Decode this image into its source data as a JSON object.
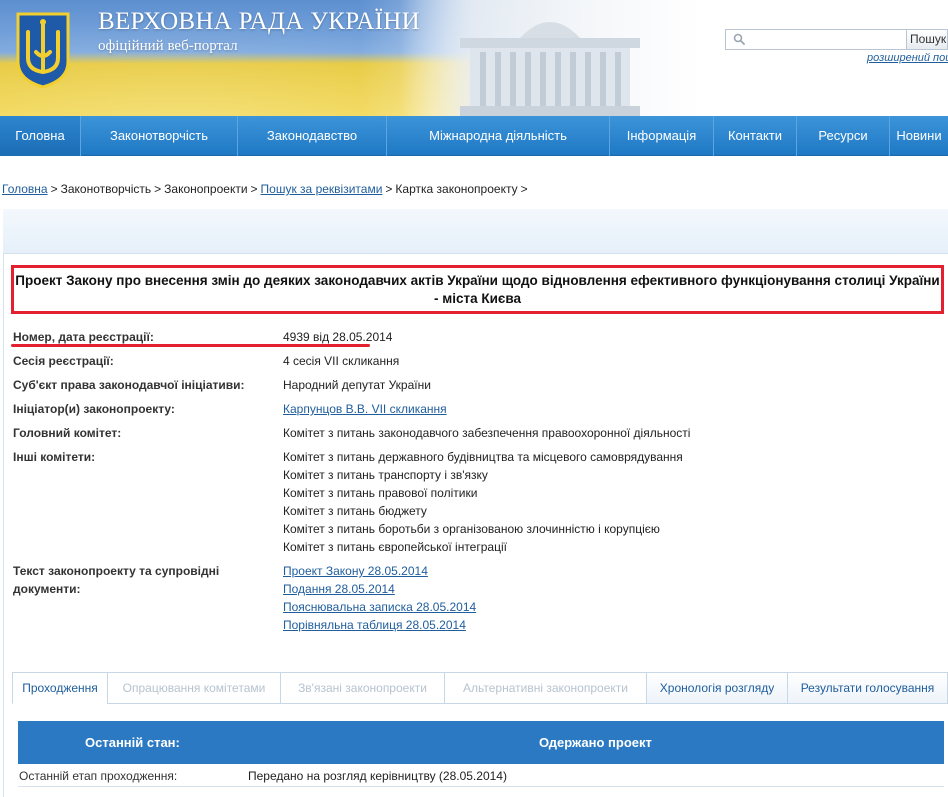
{
  "header": {
    "title": "ВЕРХОВНА РАДА УКРАЇНИ",
    "subtitle": "офіційний веб-портал",
    "search_placeholder": "",
    "search_button": "Пошук",
    "advanced_search": "розширений пошук",
    "coat_of_arms_icon": "trident-icon",
    "colors": {
      "flag_blue": "#5d8fd0",
      "flag_yellow": "#f1d64f"
    }
  },
  "nav": {
    "items": [
      {
        "label": "Головна"
      },
      {
        "label": "Законотворчість"
      },
      {
        "label": "Законодавство"
      },
      {
        "label": "Міжнародна діяльність"
      },
      {
        "label": "Інформація"
      },
      {
        "label": "Контакти"
      },
      {
        "label": "Ресурси"
      },
      {
        "label": "Новини"
      }
    ],
    "color": "#2a83cc"
  },
  "breadcrumb": {
    "items": [
      {
        "label": "Головна",
        "link": true
      },
      {
        "label": "Законотворчість",
        "link": false
      },
      {
        "label": "Законопроекти",
        "link": false
      },
      {
        "label": "Пошук за реквізитами",
        "link": true
      },
      {
        "label": "Картка законопроекту",
        "link": false
      }
    ],
    "separator": ">"
  },
  "bill": {
    "title": "Проект Закону про внесення змін до деяких законодавчих актів України щодо відновлення ефективного функціонування столиці України - міста Києва",
    "rows": {
      "number_label": "Номер, дата реєстрації:",
      "number_value": "4939 від 28.05.2014",
      "session_label": "Сесія реєстрації:",
      "session_value": "4 сесія VII скликання",
      "subject_label": "Суб'єкт права законодавчої ініціативи:",
      "subject_value": "Народний депутат України",
      "initiator_label": "Ініціатор(и) законопроекту:",
      "initiator_value": "Карпунцов В.В. VII скликання ",
      "main_committee_label": "Головний комітет:",
      "main_committee_value": "Комітет з питань законодавчого забезпечення правоохоронної діяльності",
      "other_committees_label": "Інші комітети:",
      "other_committees": [
        "Комітет з питань державного будівництва та місцевого самоврядування",
        "Комітет з питань транспорту і зв'язку",
        "Комітет з питань правової політики",
        "Комітет з питань бюджету",
        "Комітет з питань боротьби з організованою злочинністю і корупцією",
        "Комітет з питань європейської інтеграції"
      ],
      "documents_label_1": "Текст законопроекту та супровідні",
      "documents_label_2": "документи:",
      "documents": [
        "Проект Закону 28.05.2014",
        "Подання 28.05.2014",
        "Пояснювальна записка 28.05.2014",
        "Порівняльна таблиця 28.05.2014"
      ]
    },
    "highlight_color": "#e3202f"
  },
  "tabs": [
    {
      "label": "Проходження"
    },
    {
      "label": "Опрацювання комітетами"
    },
    {
      "label": "Зв'язані законопроекти"
    },
    {
      "label": "Альтернативні законопроекти"
    },
    {
      "label": "Хронологія розгляду"
    },
    {
      "label": "Результати голосування"
    }
  ],
  "status": {
    "last_state_label": "Останній стан:",
    "last_state_value": "Одержано проект",
    "last_stage_label": "Останній етап проходження:",
    "last_stage_value": "Передано на розгляд керівництву (28.05.2014)",
    "bar_color": "#2a79c2"
  }
}
